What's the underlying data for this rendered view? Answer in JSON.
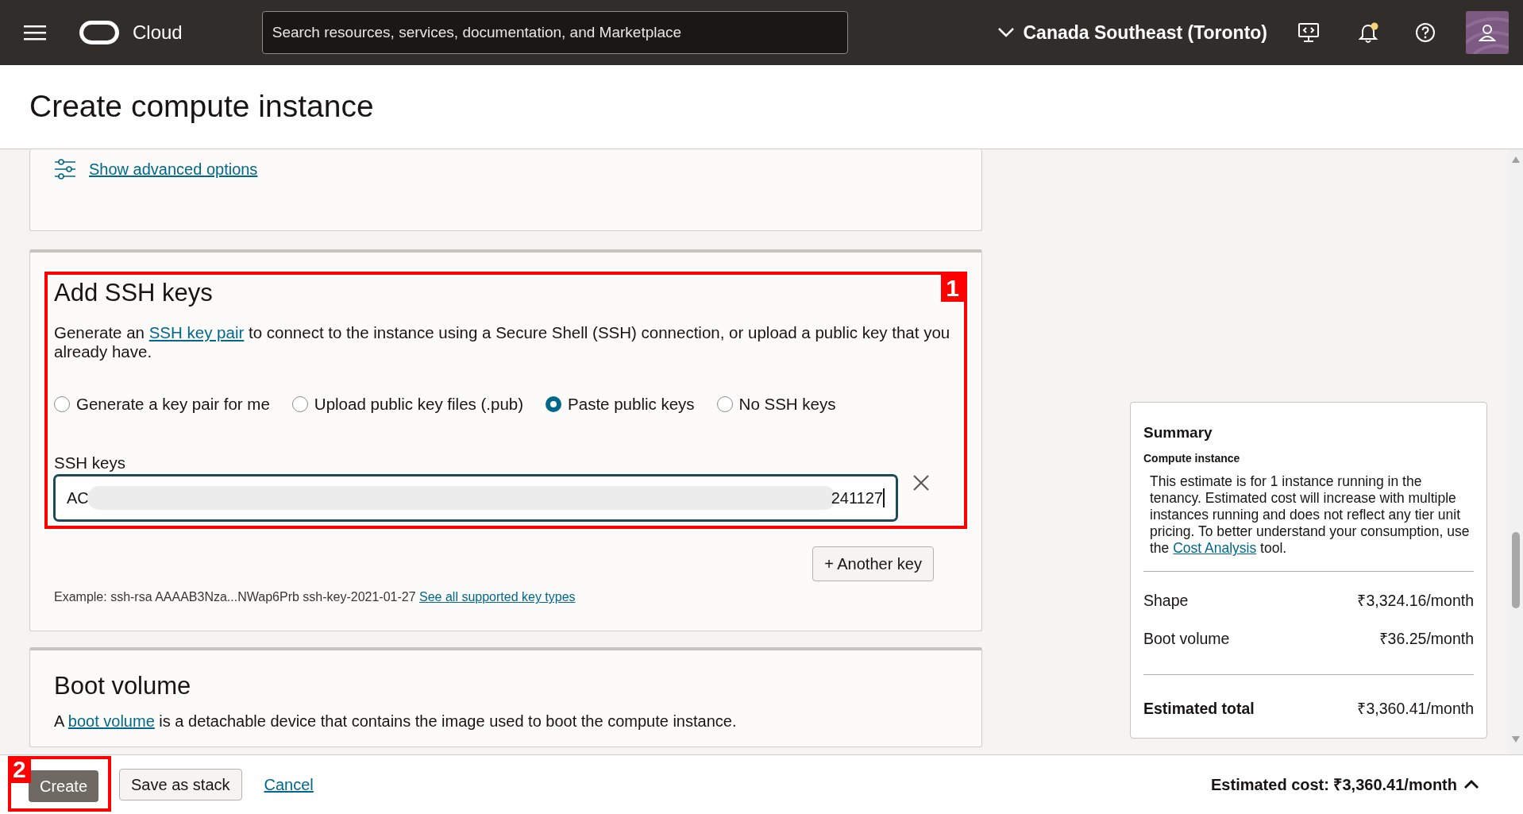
{
  "header": {
    "brand": "Cloud",
    "search": {
      "placeholder": "Search resources, services, documentation, and Marketplace"
    },
    "region": "Canada Southeast (Toronto)",
    "notifications_unread": true
  },
  "page_title": "Create compute instance",
  "advanced_link": "Show advanced options",
  "ssh": {
    "title": "Add SSH keys",
    "description_before": "Generate an ",
    "description_link": "SSH key pair",
    "description_after": " to connect to the instance using a Secure Shell (SSH) connection, or upload a public key that you already have.",
    "options": [
      {
        "label": "Generate a key pair for me",
        "selected": false
      },
      {
        "label": "Upload public key files (.pub)",
        "selected": false
      },
      {
        "label": "Paste public keys",
        "selected": true
      },
      {
        "label": "No SSH keys",
        "selected": false
      }
    ],
    "field_label": "SSH keys",
    "value_start": "AC",
    "value_end": "241127",
    "redacted": true,
    "add_button": "+ Another key",
    "example": "Example: ssh-rsa AAAAB3Nza...NWap6Prb ssh-key-2021-01-27",
    "example_link": "See all supported key types"
  },
  "boot_volume": {
    "title": "Boot volume",
    "text_before": "A ",
    "link": "boot volume",
    "text_after": " is a detachable device that contains the image used to boot the compute instance."
  },
  "summary": {
    "title": "Summary",
    "subtitle": "Compute instance",
    "text_before": "This estimate is for 1 instance running in the tenancy. Estimated cost will increase with multiple instances running and does not reflect any tier unit pricing. To better understand your consumption, use the ",
    "link": "Cost Analysis",
    "text_after": " tool.",
    "rows": [
      {
        "label": "Shape",
        "value": "₹3,324.16/month"
      },
      {
        "label": "Boot volume",
        "value": "₹36.25/month"
      }
    ],
    "total": {
      "label": "Estimated total",
      "value": "₹3,360.41/month"
    }
  },
  "footer": {
    "buttons": [
      {
        "label": "Create",
        "kind": "primary"
      },
      {
        "label": "Save as stack",
        "kind": "secondary"
      },
      {
        "label": "Cancel",
        "kind": "link"
      }
    ],
    "estimated_cost": "Estimated cost: ₹3,360.41/month",
    "expanded": false
  },
  "annotations": [
    {
      "label": "1"
    },
    {
      "label": "2"
    }
  ]
}
